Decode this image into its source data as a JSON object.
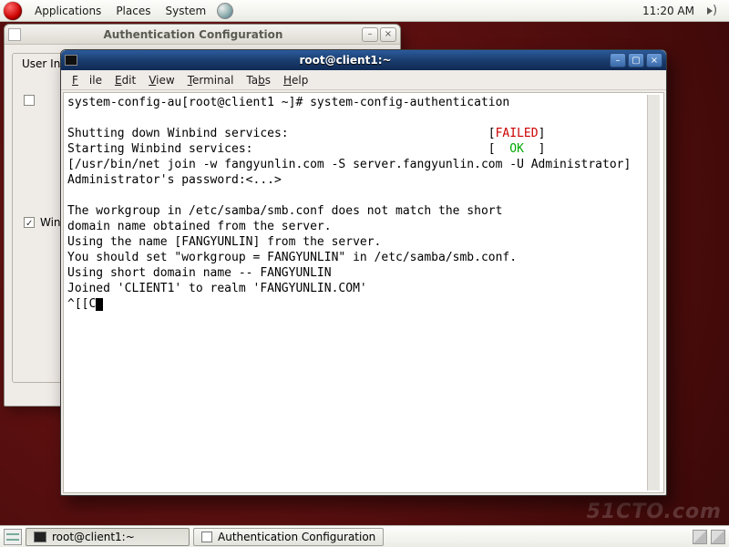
{
  "top_panel": {
    "menu": {
      "applications": "Applications",
      "places": "Places",
      "system": "System"
    },
    "clock": "11:20 AM"
  },
  "auth_window": {
    "title": "Authentication Configuration",
    "tab": "User In",
    "check_label": "Win"
  },
  "terminal": {
    "title": "root@client1:~",
    "menubar": {
      "file": "File",
      "edit": "Edit",
      "view": "View",
      "terminal": "Terminal",
      "tabs": "Tabs",
      "help": "Help"
    },
    "lines": {
      "l0": "system-config-au[root@client1 ~]# system-config-authentication",
      "l1": "",
      "l2a": "Shutting down Winbind services:                            [",
      "l2b": "FAILED",
      "l2c": "]",
      "l3a": "Starting Winbind services:                                 [  ",
      "l3b": "OK",
      "l3c": "  ]",
      "l4": "[/usr/bin/net join -w fangyunlin.com -S server.fangyunlin.com -U Administrator]",
      "l5": "Administrator's password:<...>",
      "l6": "",
      "l7": "The workgroup in /etc/samba/smb.conf does not match the short",
      "l8": "domain name obtained from the server.",
      "l9": "Using the name [FANGYUNLIN] from the server.",
      "l10": "You should set \"workgroup = FANGYUNLIN\" in /etc/samba/smb.conf.",
      "l11": "Using short domain name -- FANGYUNLIN",
      "l12": "Joined 'CLIENT1' to realm 'FANGYUNLIN.COM'",
      "l13": "^[[C"
    }
  },
  "bottom_panel": {
    "task1": "root@client1:~",
    "task2": "Authentication Configuration"
  },
  "watermark": "51CTO.com"
}
